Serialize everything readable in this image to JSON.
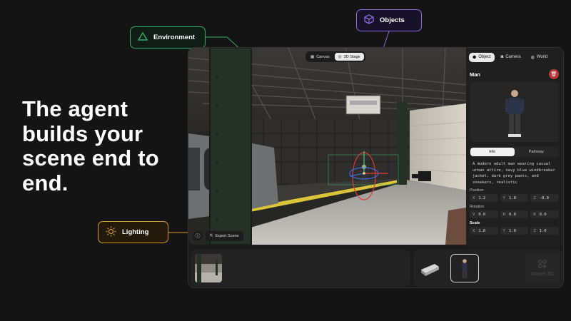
{
  "headline": "The agent builds your scene end to end.",
  "callouts": {
    "environment": "Environment",
    "objects": "Objects",
    "lighting": "Lighting"
  },
  "colors": {
    "environment": "#2fae6a",
    "objects": "#8d6ad8",
    "lighting": "#d69a2a",
    "delete": "#b63a3a"
  },
  "viewport": {
    "modes": [
      "Canvas",
      "3D Stage"
    ],
    "active_mode": "3D Stage",
    "export_label": "Export Scene"
  },
  "panel": {
    "tabs": [
      {
        "label": "Object",
        "icon": "cube-icon"
      },
      {
        "label": "Camera",
        "icon": "camera-icon"
      },
      {
        "label": "World",
        "icon": "globe-icon"
      }
    ],
    "active_tab": "Object",
    "object_name": "Man",
    "segments": [
      "Info",
      "Pathway"
    ],
    "active_segment": "Info",
    "description": "A modern adult man wearing casual urban attire, navy blue windbreaker jacket, dark grey pants, and sneakers, realistic",
    "position": {
      "label": "Position",
      "x": "1.2",
      "y": "1.0",
      "z": "-8.0"
    },
    "rotation": {
      "label": "Rotation",
      "v": "0.0",
      "h": "0.0",
      "r": "0.0"
    },
    "scale": {
      "label": "Scale",
      "x": "1.0",
      "y": "1.0",
      "z": "1.0"
    }
  },
  "tray": {
    "import_label": "Import 3D"
  }
}
